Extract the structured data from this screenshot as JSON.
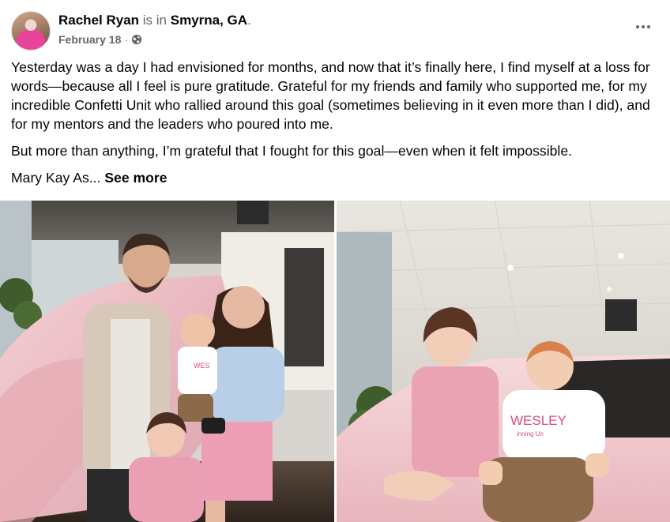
{
  "post": {
    "author": "Rachel Ryan",
    "is_in": "is in",
    "location": "Smyrna, GA",
    "location_punct": ".",
    "date": "February 18",
    "separator": "·",
    "audience_icon": "globe-icon",
    "more_icon": "ellipsis-icon",
    "paragraphs": [
      "Yesterday was a day I had envisioned for months, and now that it’s finally here, I find myself at a loss for words—because all I feel is pure gratitude. Grateful for my friends and family who supported me, for my incredible Confetti Unit who rallied around this goal (sometimes believing in it even more than I did), and for my mentors and the leaders who poured into me.",
      "But more than anything, I’m grateful that I fought for this goal—even when it felt impossible."
    ],
    "truncated_text": "Mary Kay As...",
    "see_more": "See more"
  },
  "photos": {
    "left": {
      "onesie_text": "WES"
    },
    "right": {
      "onesie_text": "WESLEY",
      "onesie_subtext": "inning Un"
    }
  },
  "colors": {
    "text_primary": "#050505",
    "text_secondary": "#65676b",
    "car_pink": "#f1c9cf",
    "outfit_pink": "#e9a3b3"
  }
}
